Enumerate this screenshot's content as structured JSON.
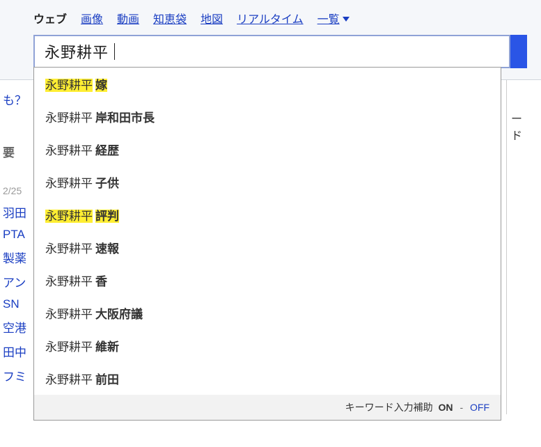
{
  "tabs": {
    "items": [
      {
        "label": "ウェブ",
        "active": true
      },
      {
        "label": "画像",
        "active": false
      },
      {
        "label": "動画",
        "active": false
      },
      {
        "label": "知恵袋",
        "active": false
      },
      {
        "label": "地図",
        "active": false
      },
      {
        "label": "リアルタイム",
        "active": false
      }
    ],
    "more_label": "一覧"
  },
  "search": {
    "query": "永野耕平"
  },
  "suggestions": [
    {
      "base": "永野耕平",
      "extra": "嫁",
      "highlight": true
    },
    {
      "base": "永野耕平",
      "extra": "岸和田市長",
      "highlight": false
    },
    {
      "base": "永野耕平",
      "extra": "経歴",
      "highlight": false
    },
    {
      "base": "永野耕平",
      "extra": "子供",
      "highlight": false
    },
    {
      "base": "永野耕平",
      "extra": "評判",
      "highlight": true
    },
    {
      "base": "永野耕平",
      "extra": "速報",
      "highlight": false
    },
    {
      "base": "永野耕平",
      "extra": "香",
      "highlight": false
    },
    {
      "base": "永野耕平",
      "extra": "大阪府議",
      "highlight": false
    },
    {
      "base": "永野耕平",
      "extra": "維新",
      "highlight": false
    },
    {
      "base": "永野耕平",
      "extra": "前田",
      "highlight": false
    }
  ],
  "suggest_footer": {
    "label": "キーワード入力補助",
    "on": "ON",
    "sep": "-",
    "off": "OFF"
  },
  "bg_left": {
    "q": "も？",
    "tab": "要",
    "date": "2/25",
    "links": [
      "羽田",
      "PTA",
      "製薬",
      "アン",
      "SN",
      "空港",
      "田中",
      "フミ"
    ]
  },
  "bg_right": {
    "kw": "ード"
  }
}
